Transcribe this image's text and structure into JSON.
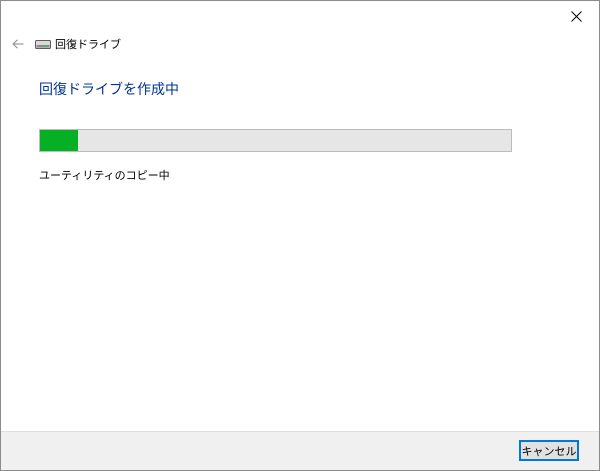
{
  "window": {
    "title": "回復ドライブ"
  },
  "header": {
    "back_icon": "arrow-left-icon",
    "drive_icon": "drive-icon",
    "title": "回復ドライブ"
  },
  "main": {
    "title": "回復ドライブを作成中",
    "progress": {
      "fraction": 0.08,
      "fill_color": "#06b025"
    },
    "status": "ユーティリティのコピー中"
  },
  "footer": {
    "cancel_label": "キャンセル"
  },
  "colors": {
    "title_blue": "#003399",
    "progress_green": "#06b025",
    "button_focus": "#0078d7"
  }
}
